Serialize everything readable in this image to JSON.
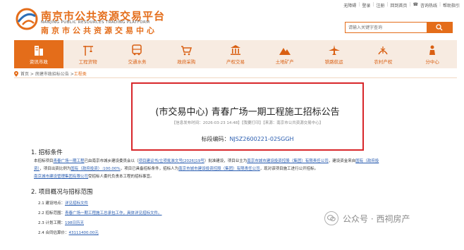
{
  "top_links": [
    "无障碍",
    "登录",
    "注册",
    "回到首页",
    "咨询热线",
    "帮助指引"
  ],
  "logo": {
    "cn": "南京市公共资源交易平台",
    "en": "NANJING PUBLIC RESOURCES TRADING PLATFORM",
    "sub": "南京市公共资源交易中心"
  },
  "search": {
    "placeholder": "请输入关键字查询"
  },
  "nav": [
    {
      "label": "资讯市政",
      "icon": "building-icon",
      "active": true
    },
    {
      "label": "工程货物",
      "icon": "crane-icon",
      "active": false
    },
    {
      "label": "交通水务",
      "icon": "bus-icon",
      "active": false
    },
    {
      "label": "政府采购",
      "icon": "cart-icon",
      "active": false
    },
    {
      "label": "产权交易",
      "icon": "bank-icon",
      "active": false
    },
    {
      "label": "土地矿产",
      "icon": "mountain-icon",
      "active": false
    },
    {
      "label": "铁路航运",
      "icon": "plane-icon",
      "active": false
    },
    {
      "label": "农村产权",
      "icon": "farm-icon",
      "active": false
    },
    {
      "label": "分中心",
      "icon": "person-icon",
      "active": false
    }
  ],
  "breadcrumb": {
    "path": "首页 > 房建市政招标公告 > ",
    "current": "工程类"
  },
  "notice": {
    "title": "(市交易中心) 青春广场一期工程施工招标公告",
    "meta": "【信息发布时间：2026-03-23 14:48】【我要打印】【来源：南京市公共资源交易中心】",
    "code_label": "标段编码：",
    "code_value": "NJSZ2600221-02SGGH"
  },
  "section1": {
    "title": "1. 招标条件",
    "line1_pre": "本招标项目",
    "line1_link1": "青春广场一期工程",
    "line1_mid": "已由南京市城乡建设委员会以（",
    "line1_link2": "项目建议书/立项批准文号[2026]19号",
    "line1_post": "）批准建设，项目业主为",
    "line1_link3": "南京市城市建设投资控股（集团）有限责任公司",
    "line1_tail": "，建设资金来自",
    "line1_link4": "国有（政府投",
    "line2_link1": "资）",
    "line2_pre": "，项目出资比例为",
    "line2_link2": "国有（政府投资）:100.00%",
    "line2_mid": "，项目已具备招标条件，招标人为",
    "line2_link3": "南京市城市建设投资控股（集团）有限责任公司",
    "line2_post": "，现对该项目施工进行公开招标。",
    "line3_link": "南京城市建设管理集团有限公司",
    "line3_post": "受招标人委托负责本工程的招标事宜。"
  },
  "section2": {
    "title": "2. 项目概况与招标范围",
    "items": [
      {
        "label": "2.1 建设地点：",
        "value": "详见招标文件"
      },
      {
        "label": "2.2 招标范围：",
        "value": "青春广场一期工程施工总承包工作，具体详见招标文件。"
      },
      {
        "label": "2.3 计划工期：",
        "value": "198日历天"
      },
      {
        "label": "2.4 合同估算价：",
        "value": "43111400.00元"
      }
    ]
  },
  "watermark": "公众号 · 西祠房产",
  "colors": {
    "brand": "#e46d1a",
    "nav_bg": "#f7ebe1",
    "highlight_border": "#d8262a",
    "link": "#2a5db0"
  }
}
